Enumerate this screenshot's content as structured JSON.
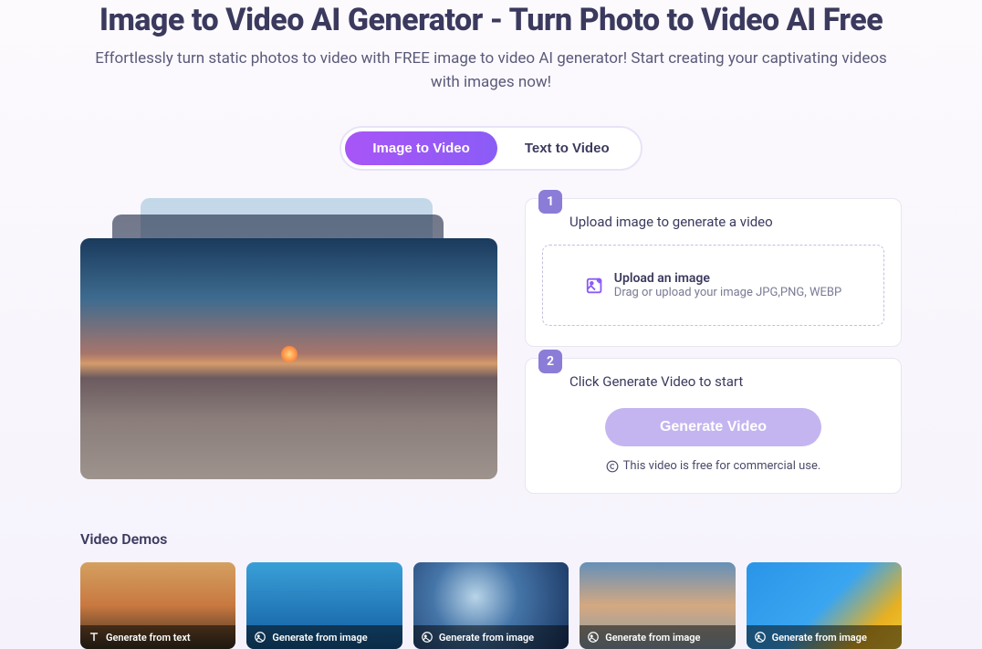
{
  "hero": {
    "title": "Image to Video AI Generator - Turn Photo to Video AI Free",
    "subtitle": "Effortlessly turn static photos to video with FREE image to video AI generator! Start creating your captivating videos with images now!"
  },
  "tabs": {
    "image_to_video": "Image to Video",
    "text_to_video": "Text to Video"
  },
  "steps": {
    "step1": {
      "number": "1",
      "title": "Upload image to generate a video",
      "upload_title": "Upload an image",
      "upload_hint": "Drag or upload your image JPG,PNG, WEBP"
    },
    "step2": {
      "number": "2",
      "title": "Click Generate Video to start",
      "button": "Generate Video",
      "note": "This video is free for commercial use."
    }
  },
  "demos": {
    "title": "Video Demos",
    "items": [
      {
        "label": "Generate from text",
        "icon": "text"
      },
      {
        "label": "Generate from image",
        "icon": "image"
      },
      {
        "label": "Generate from image",
        "icon": "image"
      },
      {
        "label": "Generate from image",
        "icon": "image"
      },
      {
        "label": "Generate from image",
        "icon": "image"
      }
    ]
  }
}
